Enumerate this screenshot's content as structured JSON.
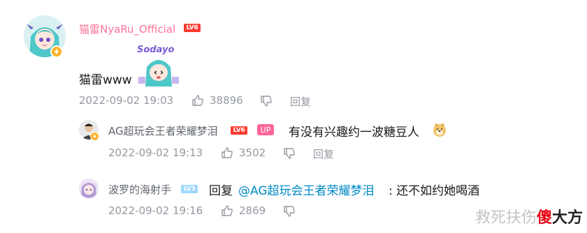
{
  "main_comment": {
    "user": {
      "name": "猫雷NyaRu_Official",
      "level": "LV6"
    },
    "text": "猫雷www",
    "sticker": {
      "label": "Sodayo"
    },
    "time": "2022-09-02 19:03",
    "likes": "38896",
    "reply_label": "回复"
  },
  "replies": [
    {
      "user": {
        "name": "AG超玩会王者荣耀梦泪",
        "level": "LV6",
        "tag": "UP"
      },
      "text": "有没有兴趣约一波糖豆人",
      "emoji": "doge-emoji",
      "time": "2022-09-02 19:13",
      "likes": "3502",
      "reply_label": "回复"
    },
    {
      "user": {
        "name": "波罗的海射手",
        "level": "LV3"
      },
      "prefix": "回复",
      "mention": "@AG超玩会王者荣耀梦泪",
      "text": ": 还不如约她喝酒",
      "time": "2022-09-02 19:16",
      "likes": "2869"
    }
  ],
  "watermark": {
    "text": "救死扶伤",
    "brand_a": "傻",
    "brand_b": "大方"
  },
  "colors": {
    "username_pink": "#fb7299",
    "meta_gray": "#9499a0",
    "mention_blue": "#008ac5",
    "level6": "#ff3b30",
    "level3": "#9ed8ff",
    "up_tag": "#ff6699"
  }
}
